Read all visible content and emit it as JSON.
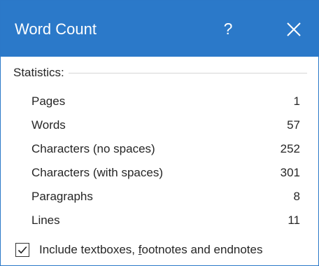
{
  "dialog": {
    "title": "Word Count",
    "help_glyph": "?",
    "close_icon": "close-icon",
    "accent_color": "#2b79c9"
  },
  "statistics": {
    "heading": "Statistics:",
    "rows": [
      {
        "label": "Pages",
        "value": "1"
      },
      {
        "label": "Words",
        "value": "57"
      },
      {
        "label": "Characters (no spaces)",
        "value": "252"
      },
      {
        "label": "Characters (with spaces)",
        "value": "301"
      },
      {
        "label": "Paragraphs",
        "value": "8"
      },
      {
        "label": "Lines",
        "value": "11"
      }
    ]
  },
  "option": {
    "checked": true,
    "label_before": "Include textboxes, ",
    "label_mnemonic": "f",
    "label_after": "ootnotes and endnotes"
  }
}
